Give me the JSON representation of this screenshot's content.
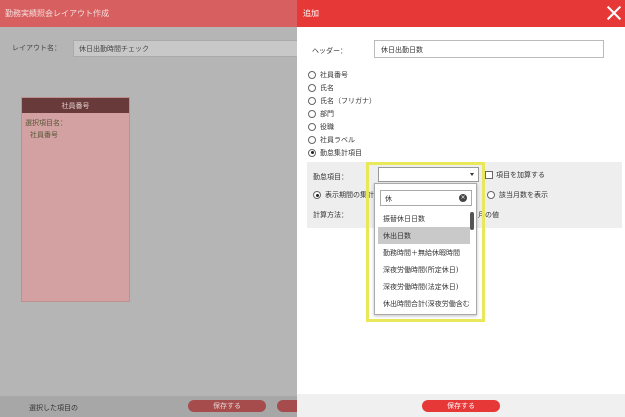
{
  "background": {
    "window_title": "勤務実績照会レイアウト作成",
    "layout_label": "レイアウト名：",
    "layout_value": "休日出勤時間チェック",
    "column": {
      "header": "社員番号",
      "line1": "選択項目名：",
      "line2": "社員番号"
    },
    "footer_text": "選択した項目の",
    "save_label": "保存する"
  },
  "panel": {
    "title": "追加",
    "header_label": "ヘッダー：",
    "header_value": "休日出勤日数",
    "radios": [
      {
        "label": "社員番号",
        "checked": false
      },
      {
        "label": "氏名",
        "checked": false
      },
      {
        "label": "氏名（フリガナ）",
        "checked": false
      },
      {
        "label": "部門",
        "checked": false
      },
      {
        "label": "役職",
        "checked": false
      },
      {
        "label": "社員ラベル",
        "checked": false
      },
      {
        "label": "勤怠集計項目",
        "checked": true
      }
    ],
    "kintai_label": "勤怠項目：",
    "add_items_label": "項目を加算する",
    "period_label": "表示期間の集",
    "period_trail": "計",
    "month_label": "該当月数を表示",
    "calc_label": "計算方法：",
    "value_label": "月の値",
    "save_label": "保存する"
  },
  "dropdown": {
    "search_value": "休",
    "items": [
      {
        "label": "振替休日日数",
        "selected": false
      },
      {
        "label": "休出日数",
        "selected": true
      },
      {
        "label": "勤務時間＋無給休暇時間",
        "selected": false
      },
      {
        "label": "深夜労働時間(所定休日)",
        "selected": false
      },
      {
        "label": "深夜労働時間(法定休日)",
        "selected": false
      },
      {
        "label": "休出時間合計(深夜労働含む)",
        "selected": false
      }
    ]
  },
  "colors": {
    "accent": "#e73838",
    "highlight": "#e8e85a"
  }
}
